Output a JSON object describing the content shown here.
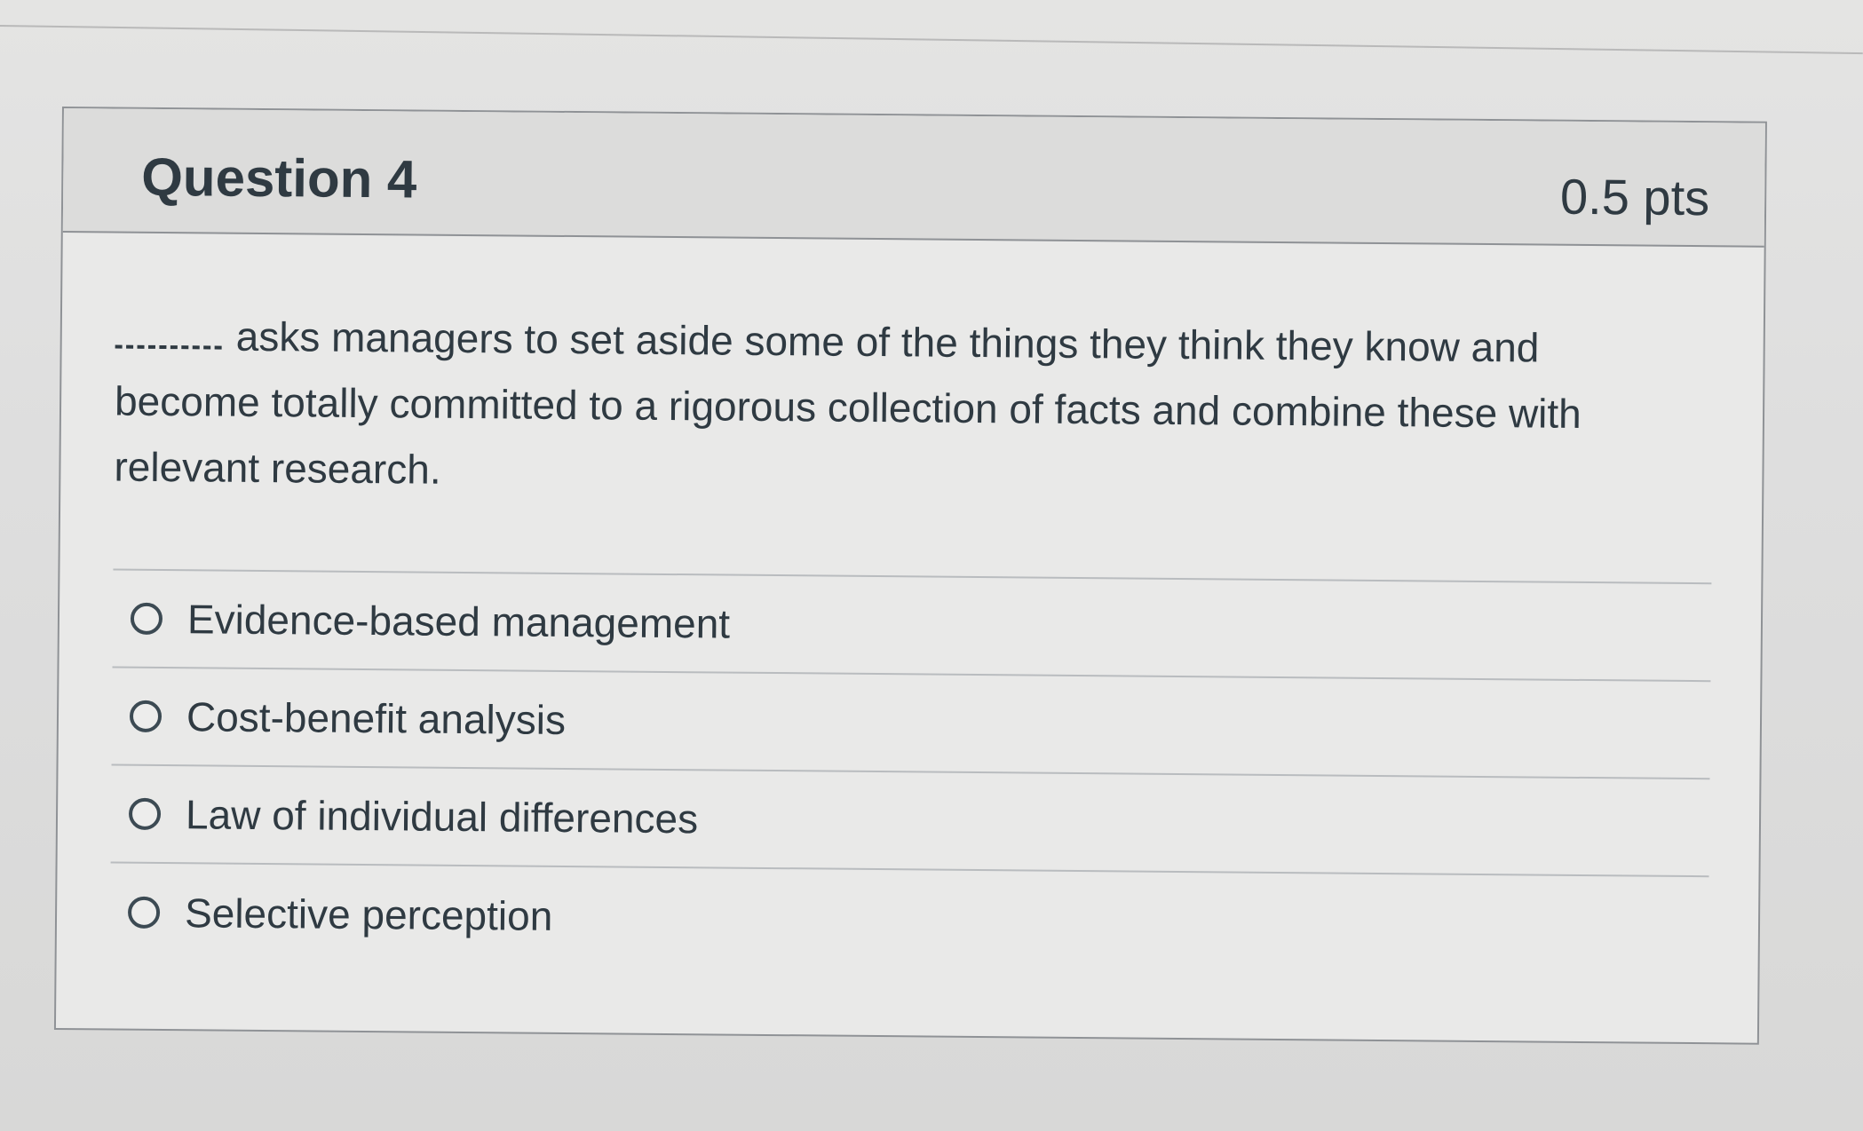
{
  "question": {
    "title": "Question 4",
    "points": "0.5 pts",
    "text": "asks managers to set aside some of the things they think they know and become totally committed to a rigorous collection of facts and combine these with relevant research."
  },
  "answers": [
    {
      "label": "Evidence-based management",
      "selected": false
    },
    {
      "label": "Cost-benefit analysis",
      "selected": false
    },
    {
      "label": "Law of individual differences",
      "selected": false
    },
    {
      "label": "Selective perception",
      "selected": false
    }
  ],
  "colors": {
    "text": "#2f3a42",
    "border": "#8f9296",
    "header_background": "#dcdcdb",
    "card_background": "#e9e9e8"
  }
}
